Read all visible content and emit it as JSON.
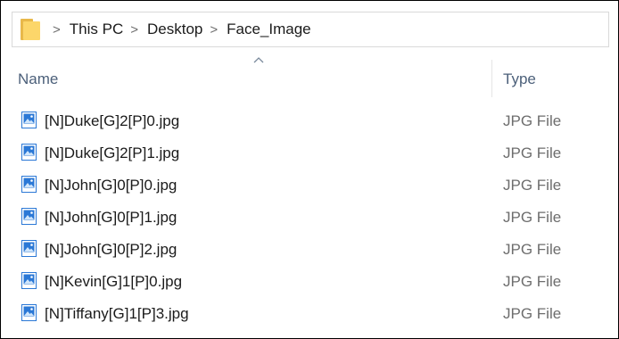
{
  "address_bar": {
    "icon": "folder-icon",
    "breadcrumbs": [
      "This PC",
      "Desktop",
      "Face_Image"
    ],
    "separator": ">"
  },
  "columns": {
    "name_label": "Name",
    "type_label": "Type",
    "sort_indicator": "sort-up-chevron-icon"
  },
  "files": [
    {
      "name": "[N]Duke[G]2[P]0.jpg",
      "type": "JPG File",
      "icon": "jpg-image-icon"
    },
    {
      "name": "[N]Duke[G]2[P]1.jpg",
      "type": "JPG File",
      "icon": "jpg-image-icon"
    },
    {
      "name": "[N]John[G]0[P]0.jpg",
      "type": "JPG File",
      "icon": "jpg-image-icon"
    },
    {
      "name": "[N]John[G]0[P]1.jpg",
      "type": "JPG File",
      "icon": "jpg-image-icon"
    },
    {
      "name": "[N]John[G]0[P]2.jpg",
      "type": "JPG File",
      "icon": "jpg-image-icon"
    },
    {
      "name": "[N]Kevin[G]1[P]0.jpg",
      "type": "JPG File",
      "icon": "jpg-image-icon"
    },
    {
      "name": "[N]Tiffany[G]1[P]3.jpg",
      "type": "JPG File",
      "icon": "jpg-image-icon"
    }
  ],
  "colors": {
    "header_text": "#4c607a",
    "file_text": "#1b1b1b",
    "type_text": "#6d6d6d",
    "folder": "#fcd66a",
    "image_icon_blue": "#2b78d6"
  }
}
